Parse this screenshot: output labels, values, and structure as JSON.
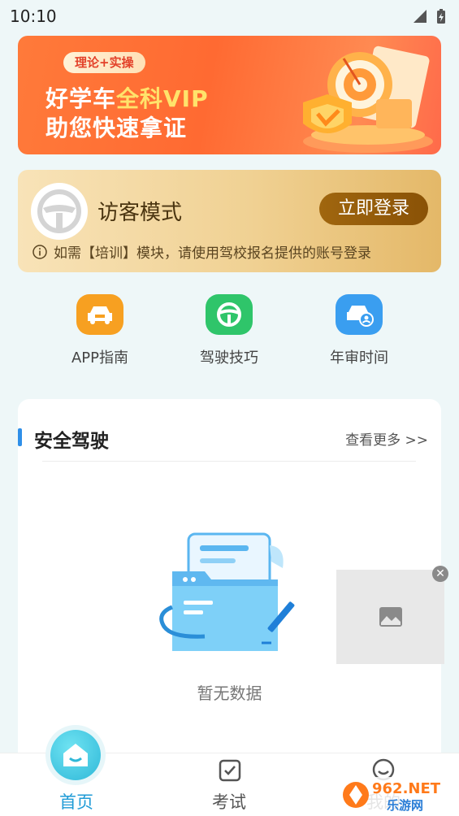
{
  "status_bar": {
    "time": "10:10"
  },
  "banner": {
    "tag": "理论+实操",
    "line1_prefix": "好学车",
    "line1_highlight": "全科VIP",
    "line2": "助您快速拿证"
  },
  "visitor": {
    "title": "访客模式",
    "login_label": "立即登录",
    "note": "如需【培训】模块，请使用驾校报名提供的账号登录"
  },
  "quick_nav": [
    {
      "label": "APP指南",
      "icon": "car-guide-icon",
      "color": "#f7a021"
    },
    {
      "label": "驾驶技巧",
      "icon": "steering-wheel-icon",
      "color": "#2fc56a"
    },
    {
      "label": "年审时间",
      "icon": "car-user-icon",
      "color": "#3a9ef0"
    }
  ],
  "section": {
    "title": "安全驾驶",
    "more": "查看更多 >>",
    "empty_text": "暂无数据"
  },
  "tabbar": {
    "tabs": [
      {
        "label": "首页",
        "icon": "home-icon",
        "active": true
      },
      {
        "label": "考试",
        "icon": "exam-check-icon",
        "active": false
      },
      {
        "label": "我的",
        "icon": "profile-icon",
        "active": false
      }
    ],
    "active_color": "#1f9bd6"
  },
  "watermark": {
    "line1": "962.NET",
    "line2": "乐游网"
  },
  "colors": {
    "accent": "#2f8fe8",
    "banner": "#ff6a32",
    "login": "#8a5206"
  }
}
